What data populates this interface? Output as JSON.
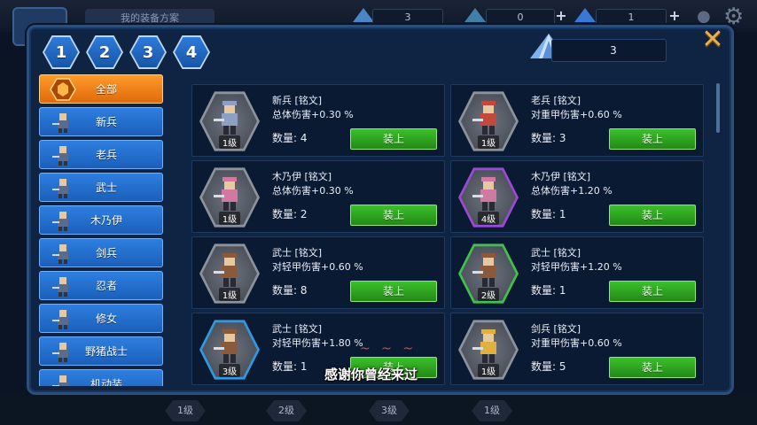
{
  "background": {
    "plan_label": "我的装备方案",
    "resources": [
      {
        "icon": "crystal-icon",
        "value": "3"
      },
      {
        "icon": "ore-icon",
        "value": "0"
      },
      {
        "icon": "diamond-icon",
        "value": "1"
      }
    ],
    "bottom_levels": [
      "1级",
      "2级",
      "3级",
      "1级"
    ]
  },
  "tabs": [
    "1",
    "2",
    "3",
    "4"
  ],
  "crystal": {
    "icon": "crystal-icon",
    "value": "3"
  },
  "close_label": "✕",
  "categories": [
    {
      "label": "全部",
      "active": true,
      "icon": "all-icon"
    },
    {
      "label": "新兵",
      "active": false,
      "icon": "recruit-icon"
    },
    {
      "label": "老兵",
      "active": false,
      "icon": "veteran-icon"
    },
    {
      "label": "武士",
      "active": false,
      "icon": "samurai-icon"
    },
    {
      "label": "木乃伊",
      "active": false,
      "icon": "mummy-icon"
    },
    {
      "label": "剑兵",
      "active": false,
      "icon": "swordsman-icon"
    },
    {
      "label": "忍者",
      "active": false,
      "icon": "ninja-icon"
    },
    {
      "label": "修女",
      "active": false,
      "icon": "nun-icon"
    },
    {
      "label": "野猪战士",
      "active": false,
      "icon": "boar-warrior-icon"
    },
    {
      "label": "机动装",
      "active": false,
      "icon": "mech-icon"
    }
  ],
  "items": [
    {
      "title": "新兵 [铭文]",
      "effect": "总体伤害+0.30 %",
      "qty": "数量: 4",
      "level": "1级",
      "frame": "#8d939c",
      "body": "#8ba0c2",
      "button": "装上"
    },
    {
      "title": "老兵 [铭文]",
      "effect": "对重甲伤害+0.60 %",
      "qty": "数量: 3",
      "level": "1级",
      "frame": "#8d939c",
      "body": "#c24a3a",
      "button": "装上"
    },
    {
      "title": "木乃伊 [铭文]",
      "effect": "总体伤害+0.30 %",
      "qty": "数量: 2",
      "level": "1级",
      "frame": "#8d939c",
      "body": "#d07aa2",
      "button": "装上"
    },
    {
      "title": "木乃伊 [铭文]",
      "effect": "总体伤害+1.20 %",
      "qty": "数量: 1",
      "level": "4级",
      "frame": "#9a4ad8",
      "body": "#d07aa2",
      "button": "装上"
    },
    {
      "title": "武士 [铭文]",
      "effect": "对轻甲伤害+0.60 %",
      "qty": "数量: 8",
      "level": "1级",
      "frame": "#8d939c",
      "body": "#8a5a3a",
      "button": "装上"
    },
    {
      "title": "武士 [铭文]",
      "effect": "对轻甲伤害+1.20 %",
      "qty": "数量: 1",
      "level": "2级",
      "frame": "#3ec24a",
      "body": "#8a5a3a",
      "button": "装上"
    },
    {
      "title": "武士 [铭文]",
      "effect": "对轻甲伤害+1.80 %",
      "qty": "数量: 1",
      "level": "3级",
      "frame": "#2f9ae0",
      "body": "#8a5a3a",
      "button": "装上"
    },
    {
      "title": "剑兵 [铭文]",
      "effect": "对重甲伤害+0.60 %",
      "qty": "数量: 5",
      "level": "1级",
      "frame": "#8d939c",
      "body": "#e0b040",
      "button": "装上"
    }
  ],
  "overlay": {
    "tilde": "~ ~ ~",
    "subtitle": "感谢你曾经来过"
  }
}
